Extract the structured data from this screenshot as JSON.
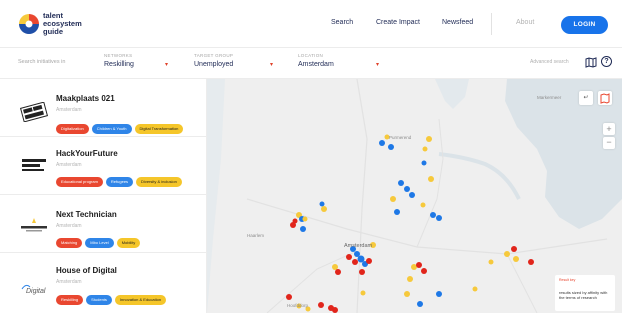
{
  "brand": {
    "line1": "talent",
    "line2": "ecosystem",
    "line3": "guide"
  },
  "nav": {
    "search": "Search",
    "create_impact": "Create Impact",
    "newsfeed": "Newsfeed",
    "about": "About",
    "login": "LOGIN"
  },
  "filters": {
    "search_placeholder": "Search initiatives in",
    "networks": {
      "label": "NETWORKS",
      "value": "Reskilling"
    },
    "target_group": {
      "label": "TARGET GROUP",
      "value": "Unemployed"
    },
    "location": {
      "label": "LOCATION",
      "value": "Amsterdam"
    },
    "advanced_search": "Advanced search"
  },
  "initiatives": [
    {
      "name": "Maakplaats 021",
      "city": "Amsterdam",
      "logo_text": "MAAK PLAATS 021",
      "tags": [
        {
          "label": "Digitalization",
          "color": "red"
        },
        {
          "label": "Children & Youth",
          "color": "blue"
        },
        {
          "label": "Digital Transformation",
          "color": "yellow"
        }
      ]
    },
    {
      "name": "HackYourFuture",
      "city": "Amsterdam",
      "logo_text": "HACK YOUR FUTURE",
      "tags": [
        {
          "label": "Educational program",
          "color": "red"
        },
        {
          "label": "Refugees",
          "color": "blue"
        },
        {
          "label": "Diversity & inclusion",
          "color": "yellow"
        }
      ]
    },
    {
      "name": "Next Technician",
      "city": "Amsterdam",
      "logo_text": "NEXT TECHNICIAN",
      "tags": [
        {
          "label": "Matching",
          "color": "red"
        },
        {
          "label": "Mbo Level",
          "color": "blue"
        },
        {
          "label": "Mobility",
          "color": "yellow"
        }
      ]
    },
    {
      "name": "House of Digital",
      "city": "Amsterdam",
      "logo_text": "Digital",
      "tags": [
        {
          "label": "Reskilling",
          "color": "red"
        },
        {
          "label": "Students",
          "color": "blue"
        },
        {
          "label": "Innovation & Education",
          "color": "yellow"
        }
      ]
    }
  ],
  "map": {
    "labels": {
      "amsterdam": "Amsterdam",
      "haarlem": "Haarlem",
      "purmerend": "Purmerend",
      "markermeer": "Markermeer",
      "hoofddorp": "Hoofddorp"
    },
    "legend_title": "Result key",
    "legend_text": "results sized by affinity with the terms of research"
  },
  "colors": {
    "red": "#e1251b",
    "blue": "#1e78e6",
    "yellow": "#f6c93c",
    "water": "#dbe3e8",
    "land": "#efefef",
    "accent": "#1873ea"
  }
}
